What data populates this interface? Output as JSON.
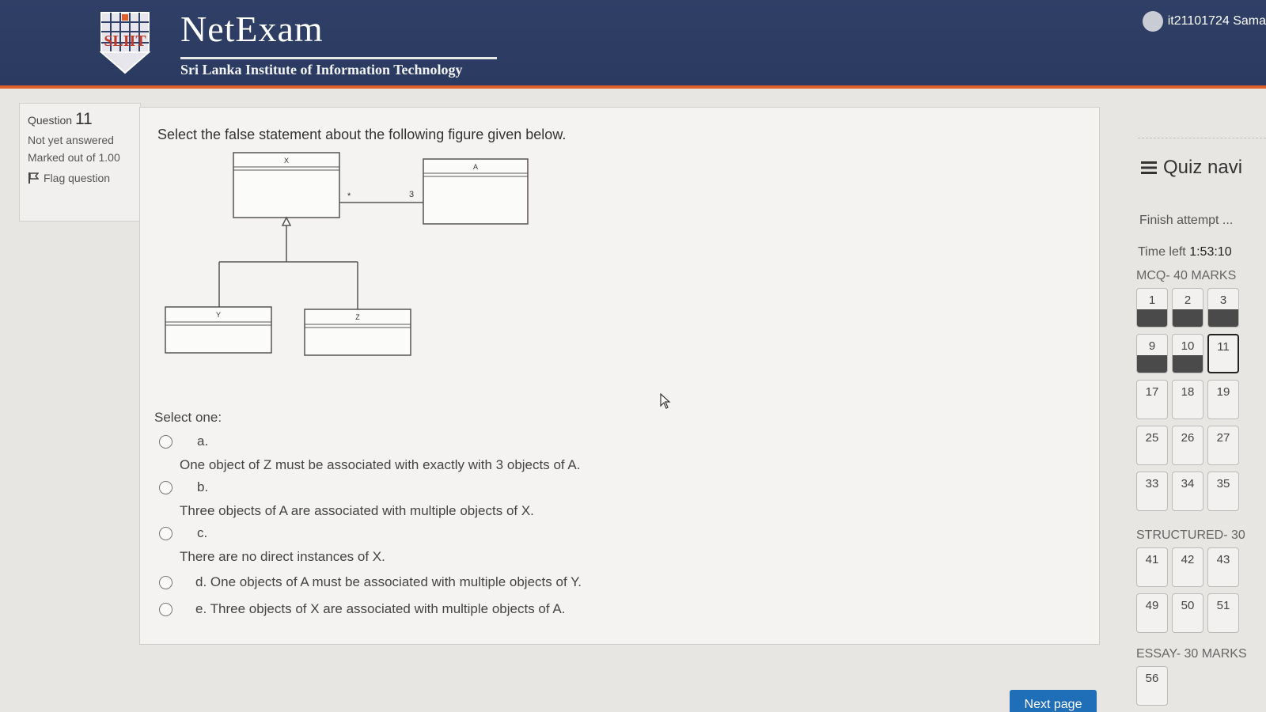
{
  "header": {
    "logo_text": "SLIIT",
    "title": "NetExam",
    "subtitle": "Sri Lanka Institute of Information Technology",
    "user_name": "it21101724 Sama"
  },
  "question_info": {
    "label": "Question",
    "number": "11",
    "status": "Not yet answered",
    "marked_out_of": "Marked out of 1.00",
    "flag": "Flag question"
  },
  "question": {
    "text": "Select the false statement about the following figure given below.",
    "diagram": {
      "classes": [
        "X",
        "A",
        "Y",
        "Z"
      ],
      "multiplicity_x_side": "*",
      "multiplicity_a_side": "3"
    },
    "select_label": "Select one:",
    "options": [
      {
        "letter": "a.",
        "text": "One object of Z must be associated with exactly with 3 objects of  A."
      },
      {
        "letter": "b.",
        "text": "Three objects of A are associated with multiple objects of X."
      },
      {
        "letter": "c.",
        "text": "There are no direct instances of X."
      },
      {
        "letter": "d.",
        "text": "One objects of A must be associated with multiple objects of Y."
      },
      {
        "letter": "e.",
        "text": "Three objects of X are associated with multiple objects of A."
      }
    ]
  },
  "nav": {
    "title": "Quiz navi",
    "finish": "Finish attempt ...",
    "time_label": "Time left",
    "time_value": "1:53:10",
    "sections": [
      {
        "label": "MCQ- 40 MARKS",
        "rows": [
          [
            "1",
            "2",
            "3"
          ],
          [
            "9",
            "10",
            "11"
          ],
          [
            "17",
            "18",
            "19"
          ],
          [
            "25",
            "26",
            "27"
          ],
          [
            "33",
            "34",
            "35"
          ]
        ]
      },
      {
        "label": "STRUCTURED- 30",
        "rows": [
          [
            "41",
            "42",
            "43"
          ],
          [
            "49",
            "50",
            "51"
          ]
        ]
      },
      {
        "label": "ESSAY- 30 MARKS",
        "rows": [
          [
            "56"
          ]
        ]
      }
    ],
    "answered": [
      "1",
      "2",
      "3",
      "9",
      "10"
    ],
    "current": "11"
  },
  "next_button": "Next page"
}
